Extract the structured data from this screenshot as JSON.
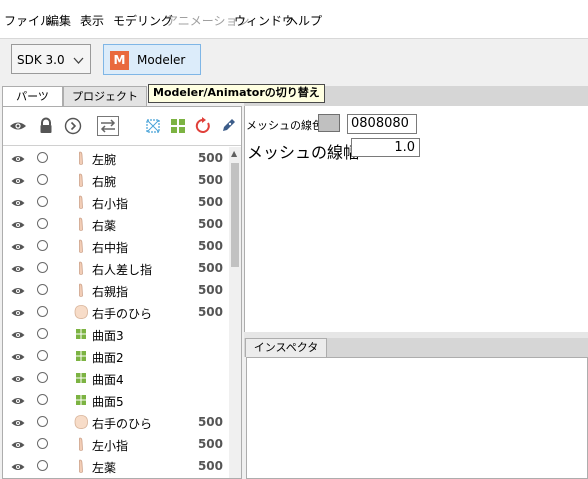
{
  "menu": [
    "ファイル",
    "編集",
    "表示",
    "モデリング",
    "アニメーション",
    "ウィンドウ",
    "ヘルプ"
  ],
  "toolbar": {
    "sdk_value": "SDK 3.0",
    "mode_button_label": "Modeler",
    "mode_logo_letter": "M",
    "tooltip": "Modeler/Animatorの切り替え"
  },
  "left_panel": {
    "tabs": [
      "パーツ",
      "プロジェクト"
    ],
    "items": [
      {
        "name": "左腕",
        "value": "500",
        "kind": "part"
      },
      {
        "name": "右腕",
        "value": "500",
        "kind": "part"
      },
      {
        "name": "右小指",
        "value": "500",
        "kind": "part"
      },
      {
        "name": "右薬",
        "value": "500",
        "kind": "part"
      },
      {
        "name": "右中指",
        "value": "500",
        "kind": "part"
      },
      {
        "name": "右人差し指",
        "value": "500",
        "kind": "part"
      },
      {
        "name": "右親指",
        "value": "500",
        "kind": "part"
      },
      {
        "name": "右手のひら",
        "value": "500",
        "kind": "palm"
      },
      {
        "name": "曲面3",
        "value": "",
        "kind": "surface"
      },
      {
        "name": "曲面2",
        "value": "",
        "kind": "surface"
      },
      {
        "name": "曲面4",
        "value": "",
        "kind": "surface"
      },
      {
        "name": "曲面5",
        "value": "",
        "kind": "surface"
      },
      {
        "name": "右手のひら",
        "value": "500",
        "kind": "palm"
      },
      {
        "name": "左小指",
        "value": "500",
        "kind": "part"
      },
      {
        "name": "左薬",
        "value": "500",
        "kind": "part"
      }
    ]
  },
  "properties": {
    "mesh_line_color_label": "メッシュの線色",
    "mesh_line_color_value": "0808080",
    "mesh_line_width_label": "メッシュの線幅",
    "mesh_line_width_value": "1.0"
  },
  "inspector": {
    "tab_label": "インスペクタ"
  },
  "colors": {
    "accent": "#e9693d",
    "selected_button": "#dcecfa",
    "surface_icon": "#7cb342",
    "swatch": "#c0c0c0"
  }
}
